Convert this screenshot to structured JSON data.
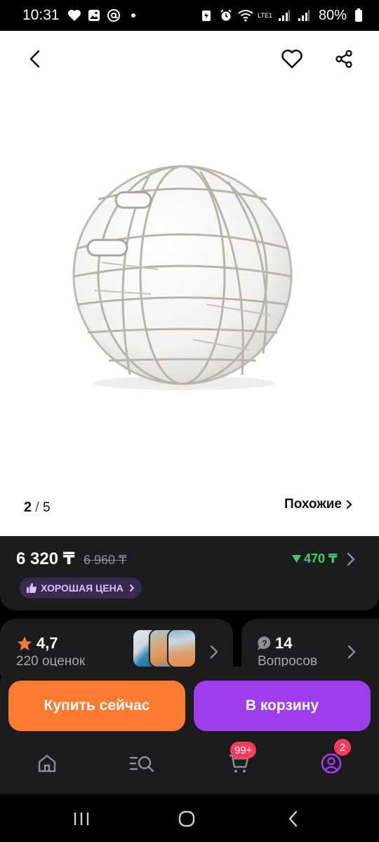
{
  "status_bar": {
    "time": "10:31",
    "battery": "80%",
    "network_label": "LTE1"
  },
  "gallery": {
    "current_index": "2",
    "separator": "/",
    "total": "5",
    "similar_label": "Похожие"
  },
  "product": {
    "price": "6 320 ₸",
    "old_price": "6 960 ₸",
    "discount": "470 ₸",
    "badge": "ХОРОШАЯ ЦЕНА",
    "rating": "4,7",
    "rating_count": "220 оценок",
    "questions_count": "14",
    "questions_label": "Вопросов"
  },
  "actions": {
    "buy_now": "Купить сейчас",
    "add_to_cart": "В корзину"
  },
  "tabbar": {
    "cart_badge": "99+",
    "profile_badge": "2"
  },
  "colors": {
    "accent_orange": "#ff7a2e",
    "accent_purple": "#a03cf0",
    "discount_green": "#3ad06a",
    "badge_red": "#ff3b5c"
  }
}
